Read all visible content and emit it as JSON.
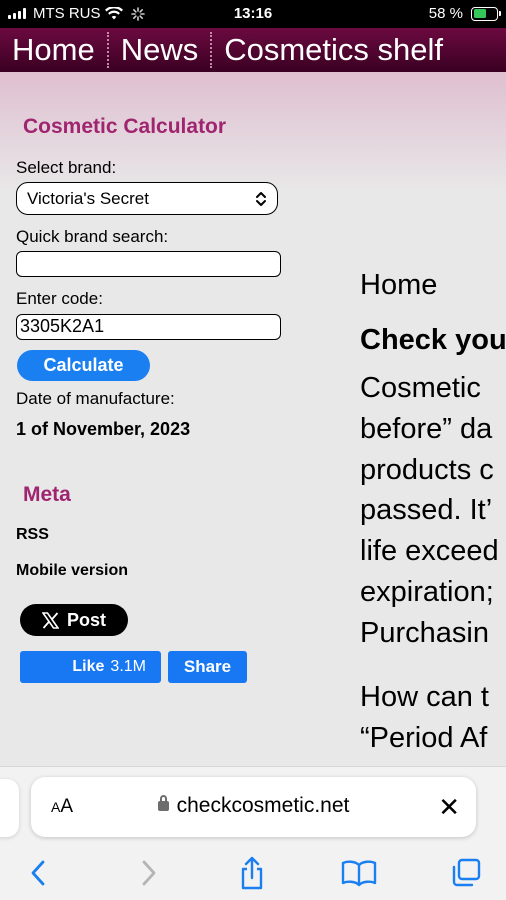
{
  "status_bar": {
    "carrier": "MTS RUS",
    "time": "13:16",
    "battery_percent": "58 %",
    "battery_level": 0.58
  },
  "site_nav": {
    "items": [
      {
        "label": "Home"
      },
      {
        "label": "News"
      },
      {
        "label": "Cosmetics shelf"
      }
    ]
  },
  "calculator": {
    "title": "Cosmetic Calculator",
    "select_brand_label": "Select brand:",
    "selected_brand": "Victoria's Secret",
    "quick_search_label": "Quick brand search:",
    "quick_search_value": "",
    "code_label": "Enter code:",
    "code_value": "3305K2A1",
    "calculate_label": "Calculate",
    "result_label": "Date of manufacture:",
    "result_value": "1 of November, 2023"
  },
  "meta": {
    "title": "Meta",
    "links": [
      {
        "label": "RSS"
      },
      {
        "label": "Mobile version"
      }
    ]
  },
  "social": {
    "post_label": "Post",
    "like_label": "Like",
    "like_count": "3.1M",
    "share_label": "Share"
  },
  "main": {
    "breadcrumb": "Home",
    "heading": "Check you",
    "paragraph_lines": [
      "Cosmetic",
      "before” da",
      "products c",
      "passed. It’",
      "life exceed",
      "expiration;",
      "Purchasin"
    ],
    "paragraph2_lines": [
      "How can t",
      "“Period Af"
    ]
  },
  "browser": {
    "aa_label_small": "A",
    "aa_label_big": "A",
    "url": "checkcosmetic.net",
    "close_glyph": "✕",
    "toolbar_icons": [
      "back-icon",
      "forward-icon",
      "share-icon",
      "bookmarks-icon",
      "tabs-icon"
    ]
  }
}
